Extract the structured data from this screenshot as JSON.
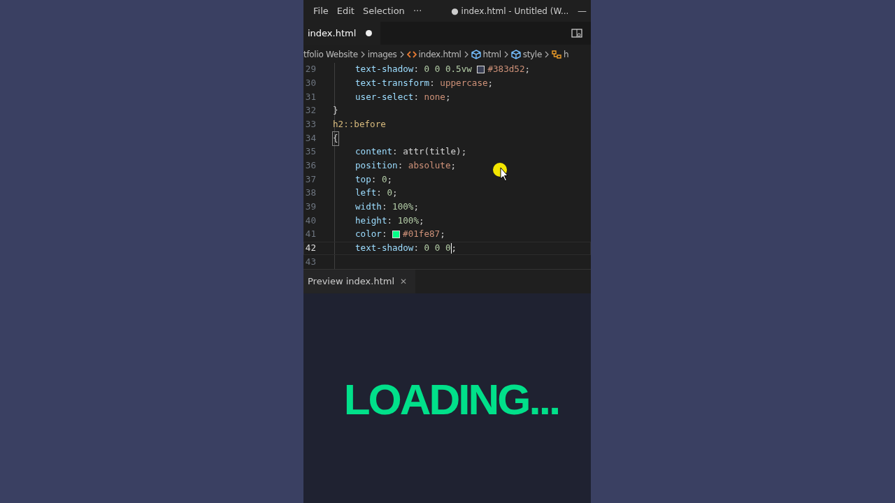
{
  "title_bar": {
    "menu": [
      "File",
      "Edit",
      "Selection",
      "···"
    ],
    "title": "● index.html - Untitled (W...",
    "minimize": "—"
  },
  "tabs": [
    {
      "label": "index.html",
      "selected": true,
      "modified": true
    }
  ],
  "breadcrumbs": [
    {
      "label": "tfolio Website",
      "kind": "folder"
    },
    {
      "label": "images",
      "kind": "folder"
    },
    {
      "label": "index.html",
      "kind": "html-file"
    },
    {
      "label": "html",
      "kind": "element"
    },
    {
      "label": "style",
      "kind": "element"
    },
    {
      "label": "h",
      "kind": "selector"
    }
  ],
  "code_lines": [
    {
      "number": "29",
      "current": false,
      "tokens": [
        {
          "kind": "indent2"
        },
        {
          "kind": "property",
          "text": "text-shadow"
        },
        {
          "kind": "punct",
          "text": ": "
        },
        {
          "kind": "number",
          "text": "0 0 0.5vw "
        },
        {
          "kind": "swatch",
          "color": "#383d52"
        },
        {
          "kind": "value",
          "text": "#383d52"
        },
        {
          "kind": "punct",
          "text": ";"
        }
      ]
    },
    {
      "number": "30",
      "current": false,
      "tokens": [
        {
          "kind": "indent2"
        },
        {
          "kind": "property",
          "text": "text-transform"
        },
        {
          "kind": "punct",
          "text": ": "
        },
        {
          "kind": "value",
          "text": "uppercase"
        },
        {
          "kind": "punct",
          "text": ";"
        }
      ]
    },
    {
      "number": "31",
      "current": false,
      "tokens": [
        {
          "kind": "indent2"
        },
        {
          "kind": "property",
          "text": "user-select"
        },
        {
          "kind": "punct",
          "text": ": "
        },
        {
          "kind": "value",
          "text": "none"
        },
        {
          "kind": "punct",
          "text": ";"
        }
      ]
    },
    {
      "number": "32",
      "current": false,
      "tokens": [
        {
          "kind": "indent1"
        },
        {
          "kind": "punct",
          "text": "}"
        }
      ]
    },
    {
      "number": "33",
      "current": false,
      "tokens": [
        {
          "kind": "indent1"
        },
        {
          "kind": "selector",
          "text": "h2::before"
        }
      ]
    },
    {
      "number": "34",
      "current": false,
      "tokens": [
        {
          "kind": "indent1"
        },
        {
          "kind": "bracket",
          "text": "{"
        }
      ]
    },
    {
      "number": "35",
      "current": false,
      "tokens": [
        {
          "kind": "indent2"
        },
        {
          "kind": "property",
          "text": "content"
        },
        {
          "kind": "punct",
          "text": ": attr(title);"
        }
      ]
    },
    {
      "number": "36",
      "current": false,
      "tokens": [
        {
          "kind": "indent2"
        },
        {
          "kind": "property",
          "text": "position"
        },
        {
          "kind": "punct",
          "text": ": "
        },
        {
          "kind": "value",
          "text": "absolute"
        },
        {
          "kind": "punct",
          "text": ";"
        }
      ]
    },
    {
      "number": "37",
      "current": false,
      "tokens": [
        {
          "kind": "indent2"
        },
        {
          "kind": "property",
          "text": "top"
        },
        {
          "kind": "punct",
          "text": ": "
        },
        {
          "kind": "number",
          "text": "0"
        },
        {
          "kind": "punct",
          "text": ";"
        }
      ]
    },
    {
      "number": "38",
      "current": false,
      "tokens": [
        {
          "kind": "indent2"
        },
        {
          "kind": "property",
          "text": "left"
        },
        {
          "kind": "punct",
          "text": ": "
        },
        {
          "kind": "number",
          "text": "0"
        },
        {
          "kind": "punct",
          "text": ";"
        }
      ]
    },
    {
      "number": "39",
      "current": false,
      "tokens": [
        {
          "kind": "indent2"
        },
        {
          "kind": "property",
          "text": "width"
        },
        {
          "kind": "punct",
          "text": ": "
        },
        {
          "kind": "number",
          "text": "100%"
        },
        {
          "kind": "punct",
          "text": ";"
        }
      ]
    },
    {
      "number": "40",
      "current": false,
      "tokens": [
        {
          "kind": "indent2"
        },
        {
          "kind": "property",
          "text": "height"
        },
        {
          "kind": "punct",
          "text": ": "
        },
        {
          "kind": "number",
          "text": "100%"
        },
        {
          "kind": "punct",
          "text": ";"
        }
      ]
    },
    {
      "number": "41",
      "current": false,
      "tokens": [
        {
          "kind": "indent2"
        },
        {
          "kind": "property",
          "text": "color"
        },
        {
          "kind": "punct",
          "text": ": "
        },
        {
          "kind": "swatch",
          "color": "#01fe87"
        },
        {
          "kind": "value",
          "text": "#01fe87"
        },
        {
          "kind": "punct",
          "text": ";"
        }
      ]
    },
    {
      "number": "42",
      "current": true,
      "tokens": [
        {
          "kind": "indent2"
        },
        {
          "kind": "property",
          "text": "text-shadow"
        },
        {
          "kind": "punct",
          "text": ": "
        },
        {
          "kind": "number",
          "text": "0 0 0"
        },
        {
          "kind": "cursor"
        },
        {
          "kind": "punct",
          "text": ";"
        }
      ]
    },
    {
      "number": "43",
      "current": false
    }
  ],
  "panel_tabs": [
    {
      "label": "Preview index.html",
      "selected": true,
      "close": "✕"
    }
  ],
  "preview": {
    "heading": "LOADING..."
  }
}
